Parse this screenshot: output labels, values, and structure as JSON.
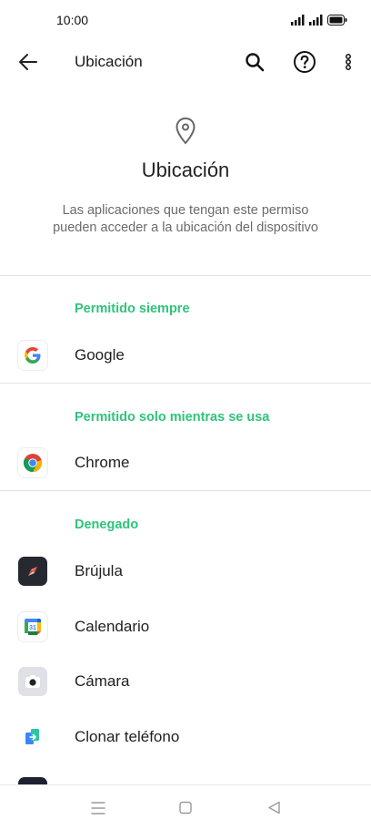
{
  "status_bar": {
    "time": "10:00"
  },
  "app_bar": {
    "title": "Ubicación"
  },
  "header": {
    "title": "Ubicación",
    "description": "Las aplicaciones que tengan este permiso pueden acceder a la ubicación del dispositivo"
  },
  "sections": {
    "always": {
      "label": "Permitido siempre",
      "apps": [
        {
          "name": "Google",
          "icon": "google-icon"
        }
      ]
    },
    "while_using": {
      "label": "Permitido solo mientras se usa",
      "apps": [
        {
          "name": "Chrome",
          "icon": "chrome-icon"
        }
      ]
    },
    "denied": {
      "label": "Denegado",
      "apps": [
        {
          "name": "Brújula",
          "icon": "compass-icon"
        },
        {
          "name": "Calendario",
          "icon": "calendar-icon"
        },
        {
          "name": "Cámara",
          "icon": "camera-icon"
        },
        {
          "name": "Clonar teléfono",
          "icon": "clone-phone-icon"
        }
      ]
    }
  },
  "colors": {
    "accent": "#2fc37b",
    "divider": "#e2e2e2"
  }
}
